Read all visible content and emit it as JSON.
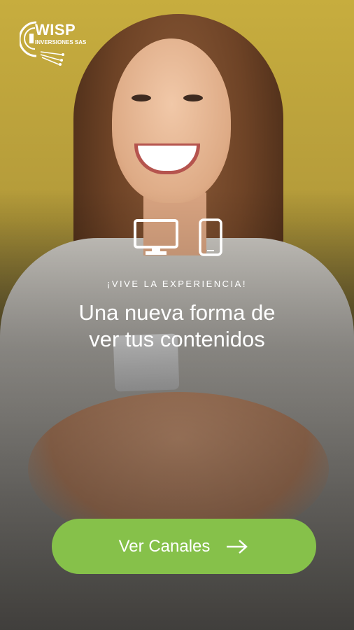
{
  "logo": {
    "brand": "WISP",
    "subtitle": "INVERSIONES SAS"
  },
  "icons": {
    "tv": "monitor-icon",
    "phone": "smartphone-icon",
    "arrow": "arrow-right-icon"
  },
  "hero": {
    "tagline": "¡VIVE LA EXPERIENCIA!",
    "headline_line1": "Una nueva forma de",
    "headline_line2": "ver tus contenidos"
  },
  "cta": {
    "label": "Ver Canales"
  },
  "colors": {
    "background_top": "#c7ad3e",
    "button": "#86c14a",
    "text": "#ffffff"
  }
}
